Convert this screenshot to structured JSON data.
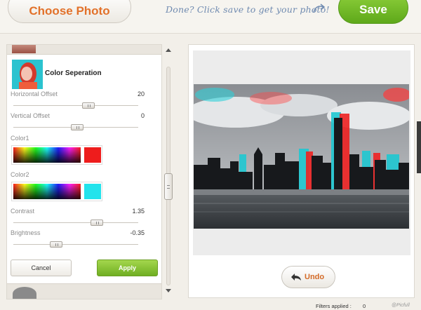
{
  "header": {
    "choose_label": "Choose Photo",
    "hint": "Done? Click save to get your photo!",
    "save_label": "Save"
  },
  "effect": {
    "title": "Color Seperation",
    "controls": {
      "horizontal_offset": {
        "label": "Horizontal Offset",
        "value": "20",
        "level": 0.6
      },
      "vertical_offset": {
        "label": "Vertical Offset",
        "value": "0",
        "level": 0.5
      },
      "color1": {
        "label": "Color1",
        "color": "#ee1c1c"
      },
      "color2": {
        "label": "Color2",
        "color": "#22e3ec"
      },
      "contrast": {
        "label": "Contrast",
        "value": "1.35",
        "level": 0.68
      },
      "brightness": {
        "label": "Brightness",
        "value": "-0.35",
        "level": 0.33
      }
    },
    "cancel_label": "Cancel",
    "apply_label": "Apply"
  },
  "preview": {
    "undo_label": "Undo"
  },
  "status": {
    "filters_label": "Filters applied :",
    "filters_count": "0",
    "watermark": "@Picfull"
  },
  "colors": {
    "accent_orange": "#e2712a",
    "accent_green": "#6fae22",
    "hint_blue": "#6f8ab0"
  }
}
